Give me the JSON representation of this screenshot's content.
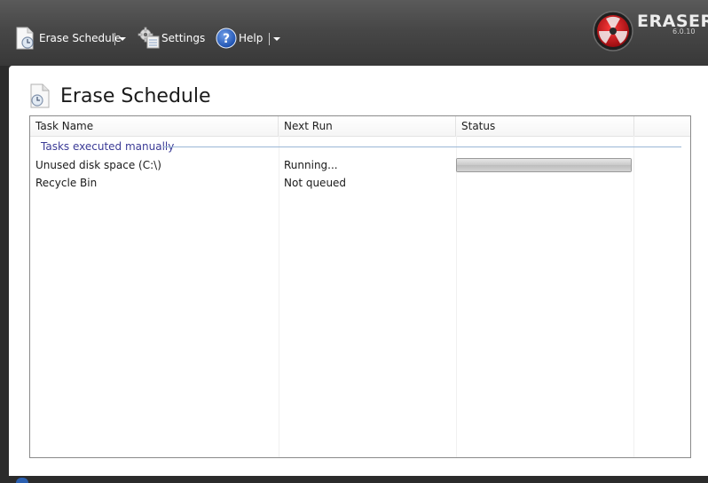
{
  "toolbar": {
    "erase_schedule_label": "Erase Schedule",
    "settings_label": "Settings",
    "help_label": "Help",
    "help_icon_text": "?"
  },
  "brand": {
    "name": "ERASER",
    "version": "6.0.10"
  },
  "page": {
    "title": "Erase Schedule"
  },
  "table": {
    "columns": [
      "Task Name",
      "Next Run",
      "Status"
    ],
    "group_label": "Tasks executed manually",
    "rows": [
      {
        "task_name": "Unused disk space (C:\\)",
        "next_run": "Running...",
        "status_progress": 1.0
      },
      {
        "task_name": "Recycle Bin",
        "next_run": "Not queued",
        "status_progress": null
      }
    ]
  },
  "colors": {
    "toolbar_bg": "#474747",
    "group_text": "#3b3b96",
    "logo_red": "#c4161c"
  }
}
